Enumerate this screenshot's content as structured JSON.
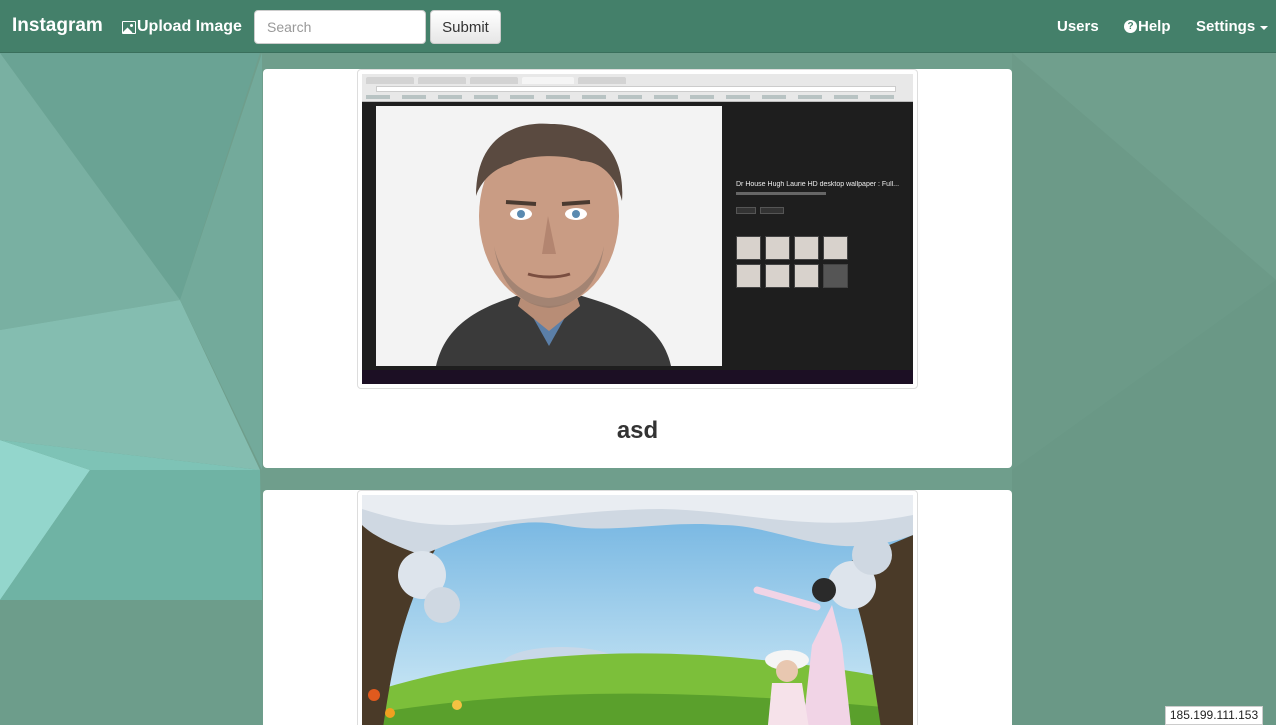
{
  "navbar": {
    "brand": "Instagram",
    "upload_label": "Upload Image",
    "search_placeholder": "Search",
    "submit_label": "Submit",
    "users_label": "Users",
    "help_label": "Help",
    "settings_label": "Settings"
  },
  "posts": [
    {
      "caption": "asd",
      "image_panel_title": "Dr House Hugh Laurie HD desktop wallpaper : Full..."
    },
    {
      "caption": ""
    }
  ],
  "footer": {
    "ip_address": "185.199.111.153"
  },
  "icons": {
    "upload": "image-icon",
    "help": "question-circle-icon",
    "settings": "caret-down-icon"
  },
  "colors": {
    "navbar": "#44806a",
    "background": "#6f9e8c",
    "card": "#ffffff"
  }
}
